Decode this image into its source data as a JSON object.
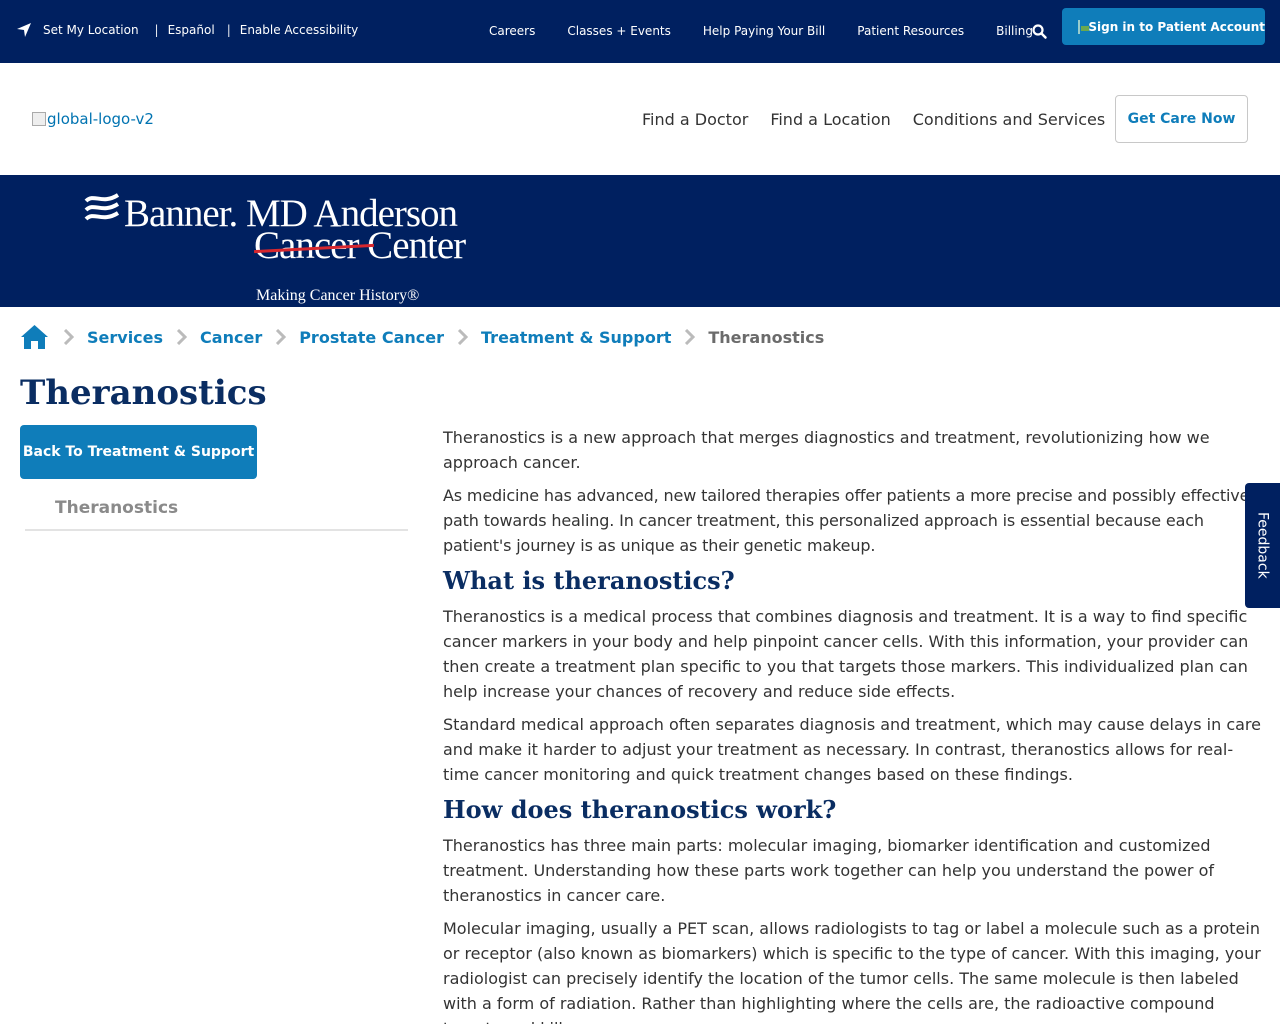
{
  "utility": {
    "location": "Set My Location",
    "spanish": "Español",
    "accessibility": "Enable Accessibility",
    "sep1": "|",
    "sep2": "|",
    "nav": [
      "Careers",
      "Classes + Events",
      "Help Paying Your Bill",
      "Patient Resources",
      "Billing"
    ],
    "sign_in": "Sign in to Patient Account"
  },
  "mainnav": {
    "logo_alt": "global-logo-v2",
    "links": [
      "Find a Doctor",
      "Find a Location",
      "Conditions and Services"
    ],
    "cta": "Get Care Now"
  },
  "banner": {
    "line1": "Banner. MD Anderson",
    "line2": "Cancer Center",
    "tagline": "Making Cancer History®"
  },
  "breadcrumb": {
    "items": [
      "Services",
      "Cancer",
      "Prostate Cancer",
      "Treatment & Support"
    ],
    "current": "Theranostics"
  },
  "page_title": "Theranostics",
  "sidebar": {
    "back_button": "Back To Treatment & Support",
    "item": "Theranostics"
  },
  "content": {
    "p1": "Theranostics is a new approach that merges diagnostics and treatment, revolutionizing how we approach cancer.",
    "p2": "As medicine has advanced, new tailored therapies offer patients a more precise and possibly effective path towards healing. In cancer treatment, this personalized approach is essential because each patient's journey is as unique as their genetic makeup.",
    "h1": "What is theranostics?",
    "p3": "Theranostics is a medical process that combines diagnosis and treatment. It is a way to find specific cancer markers in your body and help pinpoint cancer cells. With this information, your provider can then create a treatment plan specific to you that targets those markers. This individualized plan can help increase your chances of recovery and reduce side effects.",
    "p4": "Standard medical approach often separates diagnosis and treatment, which may cause delays in care and make it harder to adjust your treatment as necessary. In contrast, theranostics allows for real-time cancer monitoring and quick treatment changes based on these findings.",
    "h2": "How does theranostics work?",
    "p5": "Theranostics has three main parts: molecular imaging, biomarker identification and customized treatment. Understanding how these parts work together can help you understand the power of theranostics in cancer care.",
    "p6": "Molecular imaging, usually a PET scan, allows radiologists to tag or label a molecule such as a protein or receptor (also known as biomarkers) which is specific to the type of cancer. With this imaging, your radiologist can precisely identify the location of the tumor cells. The same molecule is then labeled with a form of radiation. Rather than highlighting where the cells are, the radioactive compound targets and kills"
  },
  "feedback": "Feedback",
  "colors": {
    "navy": "#002060",
    "accent_blue": "#0f7dba",
    "heading": "#0a2d62",
    "strike_red": "#d7272e"
  }
}
